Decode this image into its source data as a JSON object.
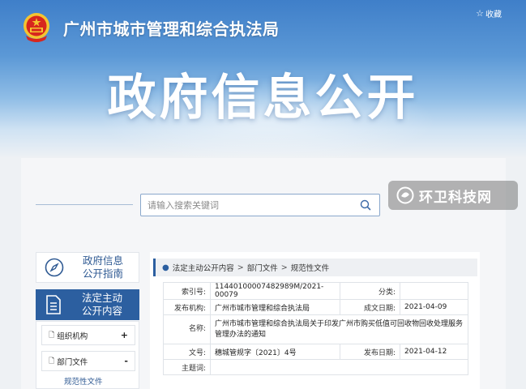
{
  "header": {
    "site_title": "广州市城市管理和综合执法局",
    "favorite_label": "收藏",
    "big_title": "政府信息公开"
  },
  "search": {
    "placeholder": "请输入搜索关键词"
  },
  "watermark": {
    "text": "环卫科技网"
  },
  "sidebar": {
    "guide_line1": "政府信息",
    "guide_line2": "公开指南",
    "active_line1": "法定主动",
    "active_line2": "公开内容",
    "menu": [
      {
        "label": "组织机构",
        "sign": "+"
      },
      {
        "label": "部门文件",
        "sign": "-"
      }
    ],
    "sub_item": "规范性文件"
  },
  "breadcrumb": {
    "items": [
      "法定主动公开内容",
      "部门文件",
      "规范性文件"
    ],
    "separator": ">"
  },
  "document": {
    "index_label": "索引号:",
    "index_value": "11440100007482989M/2021-00079",
    "category_label": "分类:",
    "category_value": "",
    "publisher_label": "发布机构:",
    "publisher_value": "广州市城市管理和综合执法局",
    "created_label": "成文日期:",
    "created_value": "2021-04-09",
    "name_label": "名称:",
    "name_value": "广州市城市管理和综合执法局关于印发广州市购买低值可回收物回收处理服务管理办法的通知",
    "docno_label": "文号:",
    "docno_value": "穗城管规字〔2021〕4号",
    "published_label": "发布日期:",
    "published_value": "2021-04-12",
    "subject_label": "主题词:",
    "subject_value": ""
  },
  "colors": {
    "primary": "#2c5fa0",
    "banner_top": "#3f7fc9",
    "emblem_red": "#d7261e",
    "emblem_gold": "#f4c430"
  }
}
